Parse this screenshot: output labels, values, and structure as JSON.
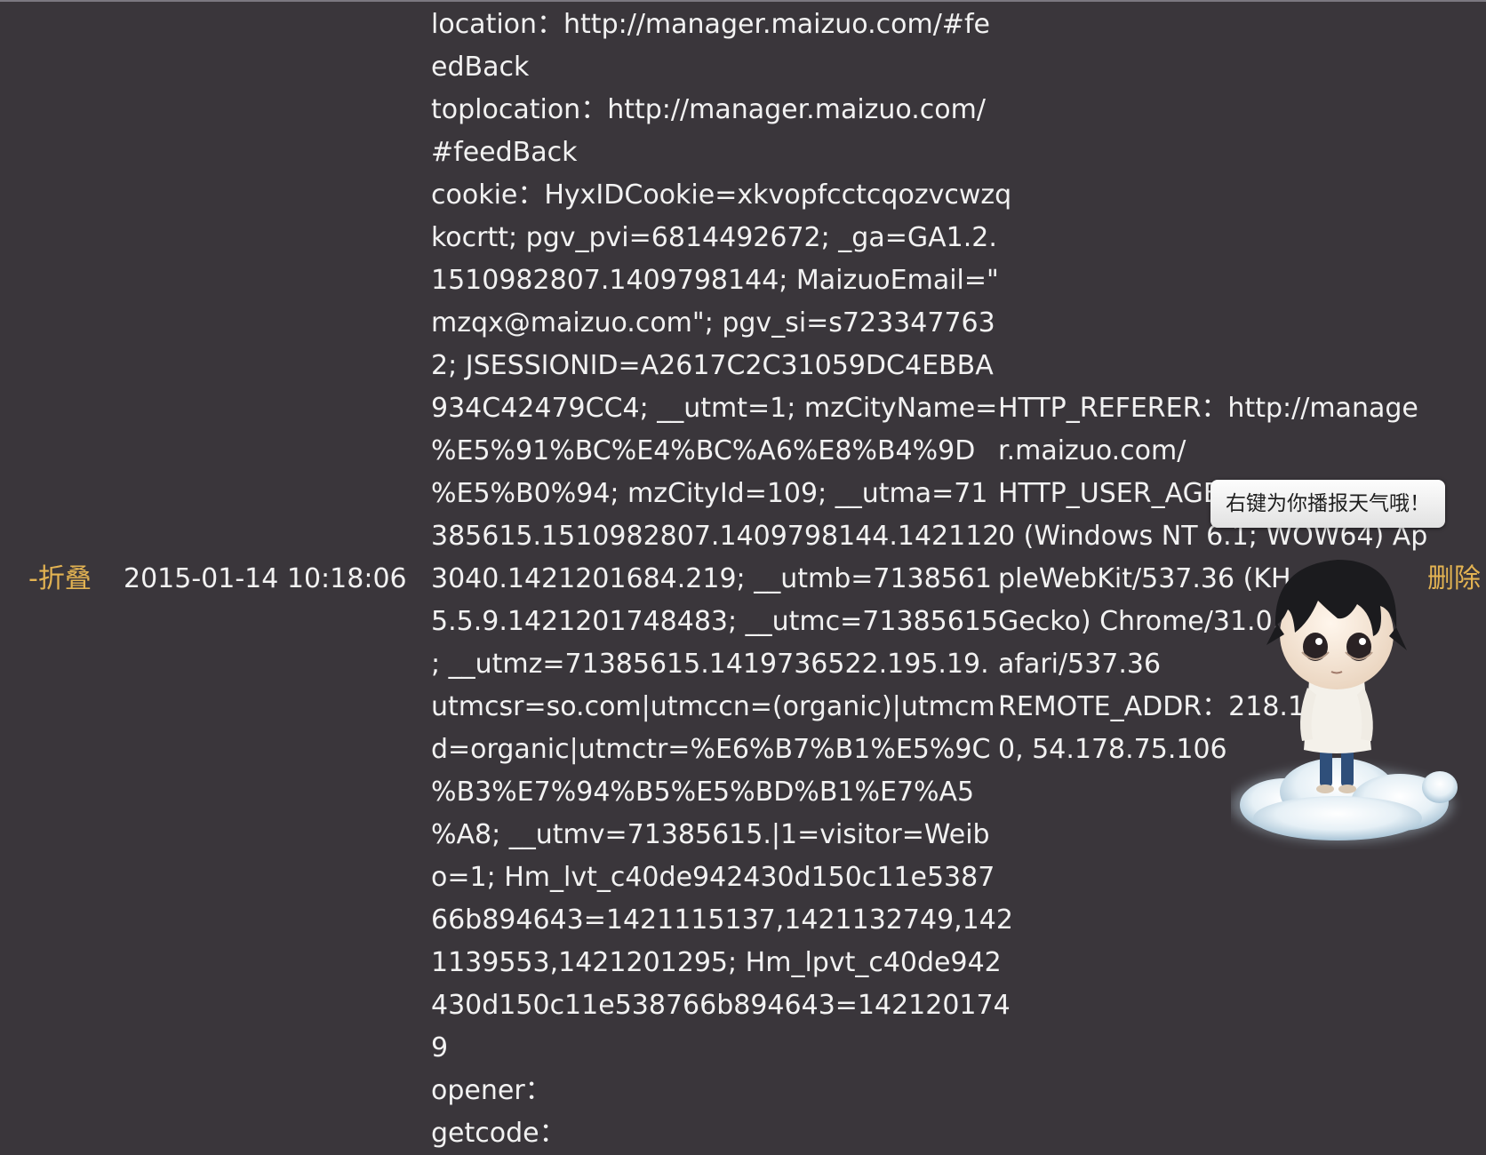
{
  "row": {
    "fold_label": "-折叠",
    "datetime": "2015-01-14 10:18:06",
    "delete_label": "删除",
    "client_info_lines": [
      "location：http://manager.maizuo.com/#fe",
      "edBack",
      "toplocation：http://manager.maizuo.com/",
      "#feedBack",
      "cookie：HyxIDCookie=xkvopfcctcqozvcwzq",
      "kocrtt; pgv_pvi=6814492672; _ga=GA1.2.",
      "1510982807.1409798144; MaizuoEmail=\"",
      "mzqx@maizuo.com\"; pgv_si=s723347763",
      "2; JSESSIONID=A2617C2C31059DC4EBBA",
      "934C42479CC4; __utmt=1; mzCityName=",
      "%E5%91%BC%E4%BC%A6%E8%B4%9D",
      "%E5%B0%94; mzCityId=109; __utma=71",
      "385615.1510982807.1409798144.142112",
      "3040.1421201684.219; __utmb=7138561",
      "5.5.9.1421201748483; __utmc=71385615",
      "; __utmz=71385615.1419736522.195.19.",
      "utmcsr=so.com|utmccn=(organic)|utmcm",
      "d=organic|utmctr=%E6%B7%B1%E5%9C",
      "%B3%E7%94%B5%E5%BD%B1%E7%A5",
      "%A8; __utmv=71385615.|1=visitor=Weib",
      "o=1; Hm_lvt_c40de942430d150c11e5387",
      "66b894643=1421115137,1421132749,142",
      "1139553,1421201295; Hm_lpvt_c40de942",
      "430d150c11e538766b894643=142120174",
      "9",
      "opener：",
      "getcode："
    ],
    "server_info_lines": [
      "HTTP_REFERER：http://manage",
      "r.maizuo.com/",
      "HTTP_USER_AGE",
      "0 (Windows NT 6.1; WOW64) Ap",
      "pleWebKit/537.36 (KH",
      "Gecko) Chrome/31.0.",
      "afari/537.36",
      "REMOTE_ADDR：218.17.",
      "0, 54.178.75.106"
    ]
  },
  "mascot": {
    "bubble_text": "右键为你播报天气哦！",
    "icon": "mascot-character-on-cloud"
  }
}
